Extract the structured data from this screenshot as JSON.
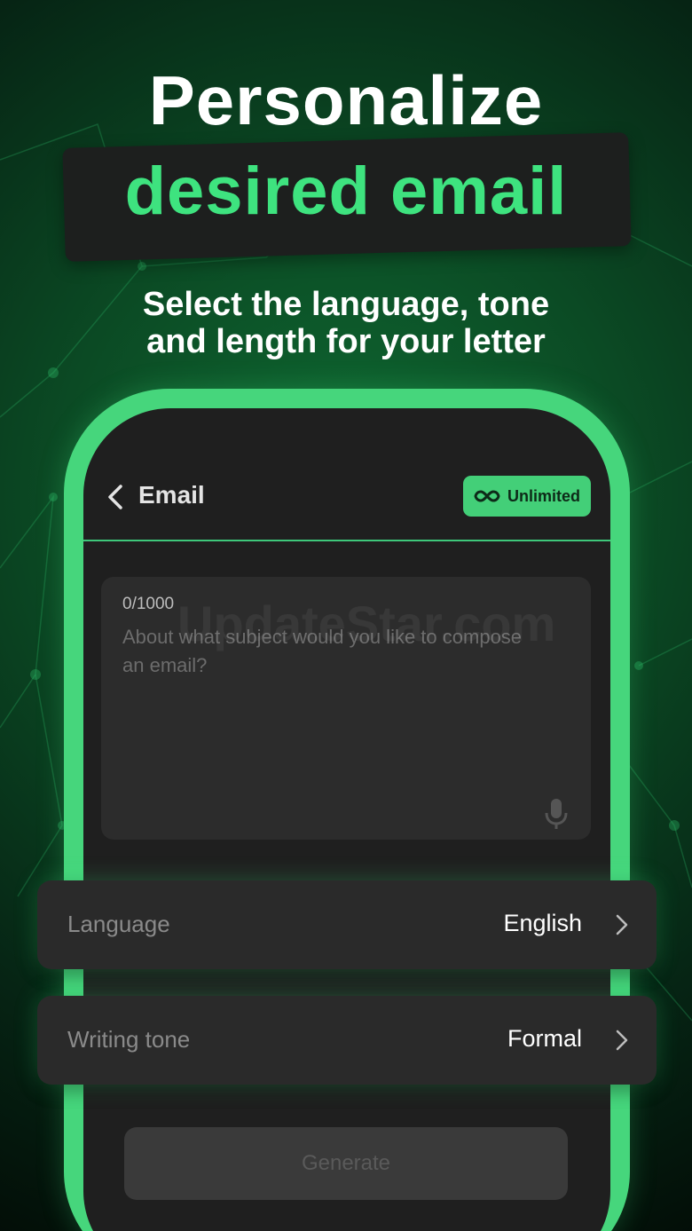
{
  "promo": {
    "headline": "Personalize",
    "highlight": "desired email",
    "subtitle_line1": "Select the language, tone",
    "subtitle_line2": "and length for your letter"
  },
  "header": {
    "title": "Email",
    "badge_label": "Unlimited",
    "back_icon": "chevron-left-icon",
    "badge_icon": "infinity-icon"
  },
  "compose": {
    "counter": "0/1000",
    "placeholder": "About what subject would you like to compose an email?",
    "mic_icon": "microphone-icon"
  },
  "options": [
    {
      "label": "Language",
      "value": "English"
    },
    {
      "label": "Writing tone",
      "value": "Formal"
    }
  ],
  "actions": {
    "generate_label": "Generate"
  },
  "watermark": "UpdateStar.com",
  "colors": {
    "accent": "#3ee37f",
    "frame": "#46d67c",
    "screen_bg": "#1f1f1f",
    "card_bg": "#2a2a2a"
  }
}
